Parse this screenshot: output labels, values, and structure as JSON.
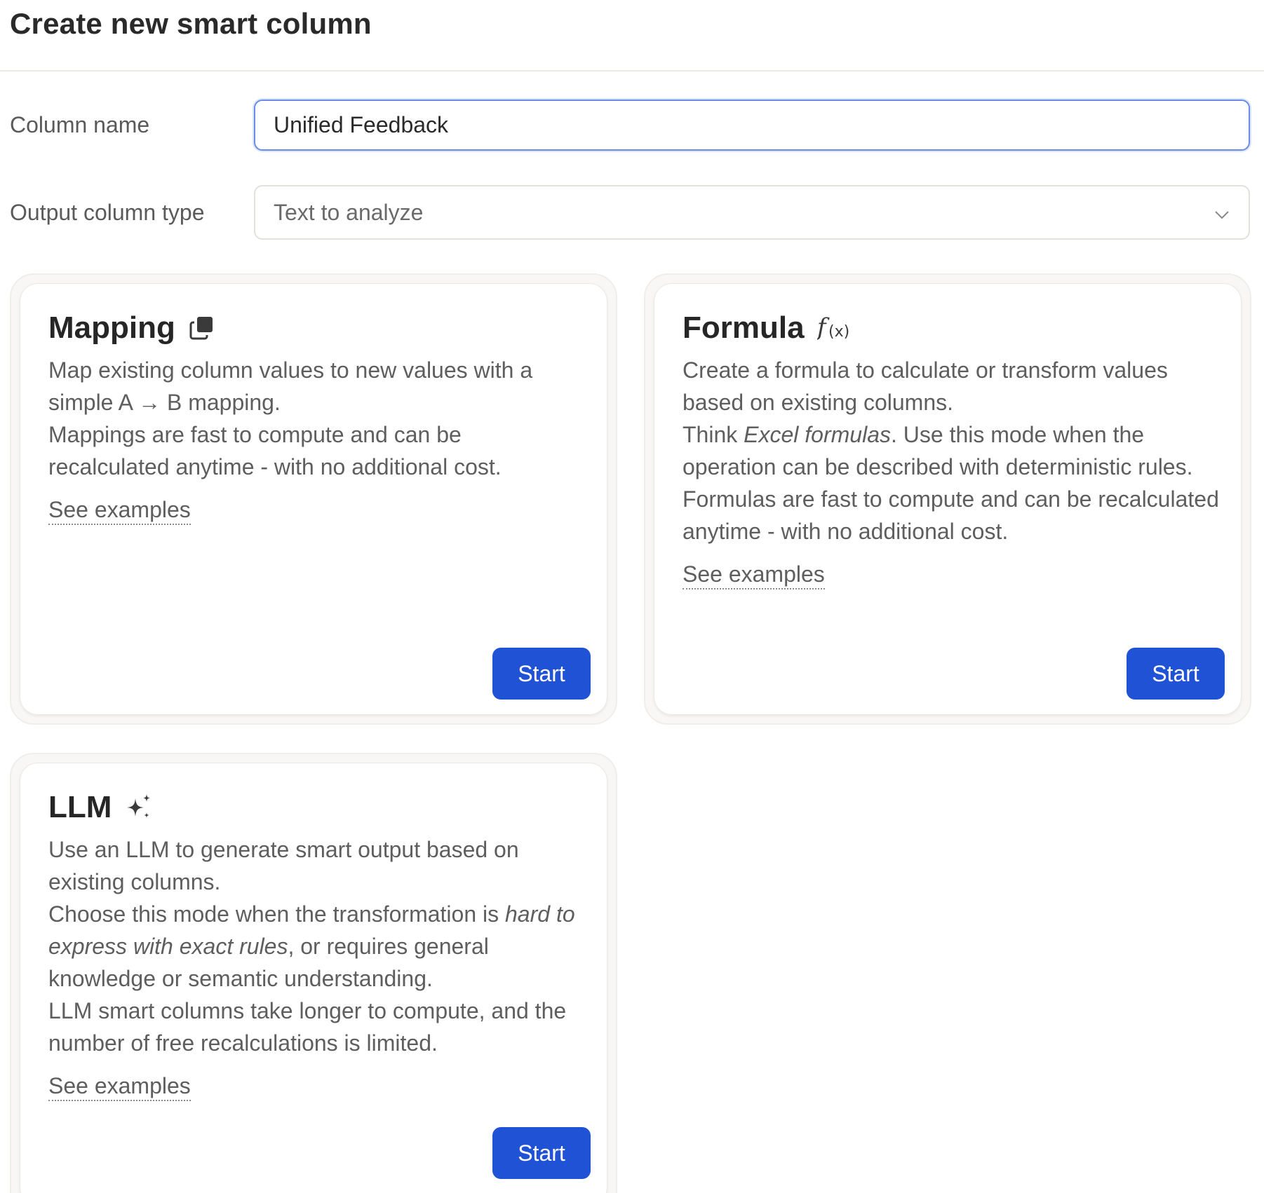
{
  "header": {
    "title": "Create new smart column"
  },
  "form": {
    "column_name_label": "Column name",
    "column_name_value": "Unified Feedback",
    "output_type_label": "Output column type",
    "output_type_value": "Text to analyze"
  },
  "cards": {
    "mapping": {
      "title": "Mapping",
      "icon": "copy-icon",
      "line1": "Map existing column values to new values with a simple A → B mapping.",
      "line2": "Mappings are fast to compute and can be recalculated anytime - with no additional cost.",
      "see_examples": "See examples",
      "start_label": "Start"
    },
    "formula": {
      "title": "Formula",
      "icon": "function-icon",
      "line1": "Create a formula to calculate or transform values based on existing columns.",
      "line2_pre": "Think ",
      "line2_em": "Excel formulas",
      "line2_post": ". Use this mode when the operation can be described with deterministic rules.",
      "line3": "Formulas are fast to compute and can be recalculated anytime - with no additional cost.",
      "see_examples": "See examples",
      "start_label": "Start"
    },
    "llm": {
      "title": "LLM",
      "icon": "sparkles-icon",
      "line1": "Use an LLM to generate smart output based on existing columns.",
      "line2_pre": "Choose this mode when the transformation is ",
      "line2_em": "hard to express with exact rules",
      "line2_post": ", or requires general knowledge or semantic understanding.",
      "line3": "LLM smart columns take longer to compute, and the number of free recalculations is limited.",
      "see_examples": "See examples",
      "start_label": "Start"
    }
  },
  "colors": {
    "accent": "#2052d6",
    "input_focus": "#6a8ee8",
    "card_border": "#f0eeea"
  }
}
